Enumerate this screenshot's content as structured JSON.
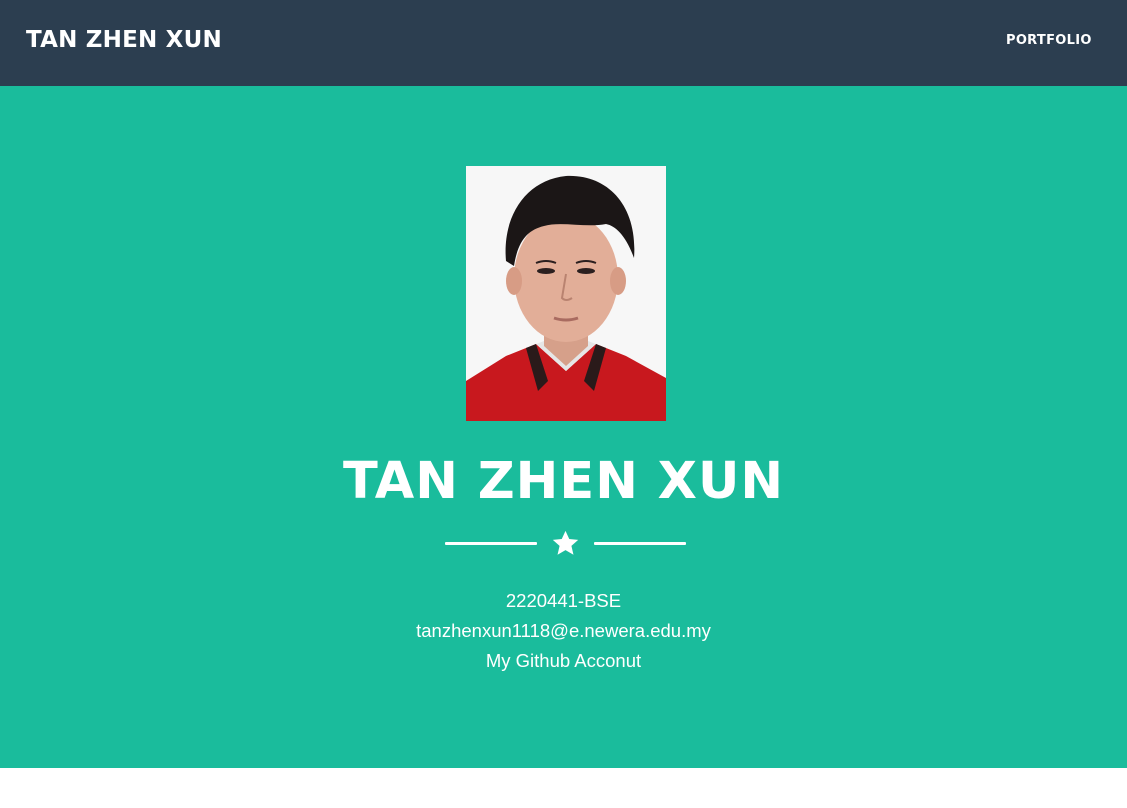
{
  "navbar": {
    "brand": "TAN ZHEN XUN",
    "links": [
      {
        "label": "PORTFOLIO"
      }
    ],
    "background": "#2c3e50"
  },
  "masthead": {
    "background": "#1abc9c",
    "avatar": {
      "alt": "profile photo"
    },
    "heading": "TAN ZHEN XUN",
    "divider_icon": "star-icon",
    "student_id": "2220441-BSE",
    "email": "tanzhenxun1118@e.newera.edu.my",
    "github_link": "My Github Acconut"
  }
}
